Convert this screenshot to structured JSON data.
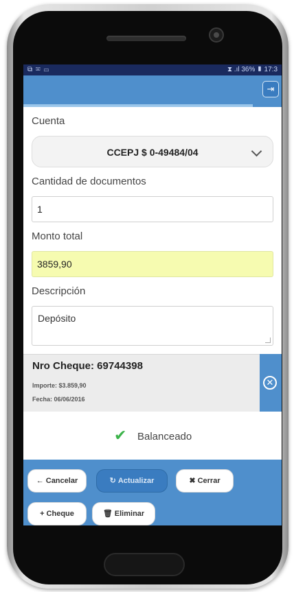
{
  "status_bar": {
    "left": "⧉ ✉ ▭",
    "right": "⧗ .ıl 36% ▮ 17:3"
  },
  "header": {
    "logout_glyph": "⇥"
  },
  "form": {
    "cuenta_label": "Cuenta",
    "cuenta_value": "CCEPJ $ 0-49484/04",
    "cantidad_label": "Cantidad de documentos",
    "cantidad_value": "1",
    "monto_label": "Monto total",
    "monto_value": "3859,90",
    "descripcion_label": "Descripción",
    "descripcion_value": "Depósito"
  },
  "cheque": {
    "title": "Nro Cheque: 69744398",
    "importe": "Importe: $3.859,90",
    "fecha": "Fecha: 06/06/2016"
  },
  "balance": {
    "text": "Balanceado"
  },
  "buttons": {
    "cancelar": "Cancelar",
    "actualizar": "Actualizar",
    "cerrar": "Cerrar",
    "cheque": "Cheque",
    "eliminar": "Eliminar"
  },
  "icons": {
    "back": "←",
    "refresh": "↻",
    "close": "✖",
    "plus": "+",
    "trash": "🗑",
    "check": "✔",
    "circle_x": "✕"
  },
  "colors": {
    "header_blue": "#4f8fcc",
    "highlight_field": "#f6fbb0",
    "success_green": "#3cb34a"
  }
}
